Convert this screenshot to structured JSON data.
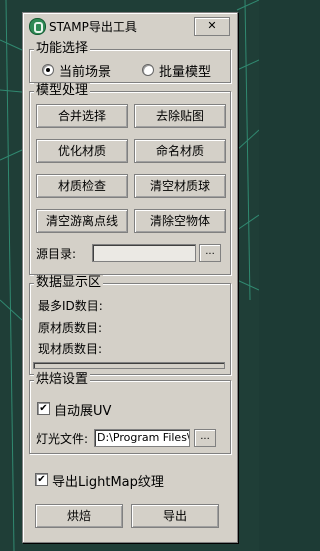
{
  "window": {
    "title": "STAMP导出工具",
    "close_label": "✕"
  },
  "function_select": {
    "legend": "功能选择",
    "options": [
      "当前场景",
      "批量模型"
    ],
    "selected": "当前场景"
  },
  "model_process": {
    "legend": "模型处理",
    "buttons": [
      "合并选择",
      "去除贴图",
      "优化材质",
      "命名材质",
      "材质检查",
      "清空材质球",
      "清空游离点线",
      "清除空物体"
    ],
    "source_dir_label": "源目录:",
    "source_dir_value": "",
    "browse_label": "..."
  },
  "data_display": {
    "legend": "数据显示区",
    "rows": [
      "最多ID数目:",
      "原材质数目:",
      "现材质数目:"
    ],
    "progress": 0
  },
  "bake_settings": {
    "legend": "烘焙设置",
    "auto_unwrap_label": "自动展UV",
    "auto_unwrap_checked": true,
    "light_file_label": "灯光文件:",
    "light_file_value": "D:\\Program Files\\A",
    "browse_label": "..."
  },
  "export_lightmap": {
    "label": "导出LightMap纹理",
    "checked": true
  },
  "actions": {
    "bake_label": "烘焙",
    "export_label": "导出"
  },
  "colors": {
    "panel": "#d4d0c8",
    "viewport": "#1d3b35",
    "grid": "#3fc7a0"
  }
}
